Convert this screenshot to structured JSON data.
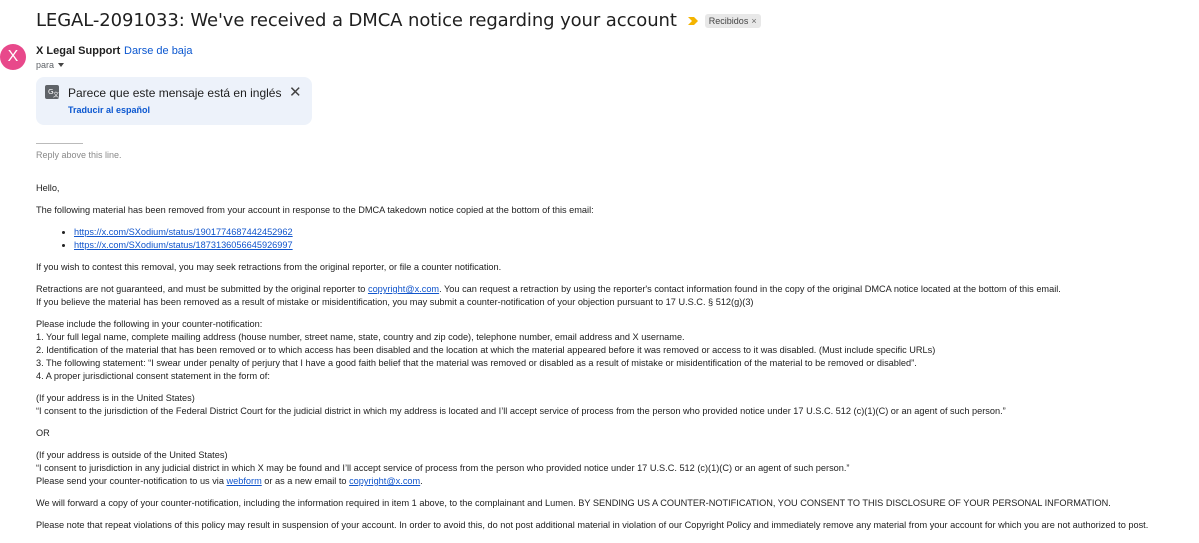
{
  "subject": "LEGAL-2091033: We've received a DMCA notice regarding your account",
  "label_chip": {
    "text": "Recibidos",
    "close": "×"
  },
  "icons": {
    "importance": "importance-marker-icon",
    "translate": "translate-icon",
    "close": "close-icon",
    "caret": "caret-down-icon"
  },
  "colors": {
    "avatar_bg": "#e8498b",
    "link": "#1155cc",
    "accent": "#0b57d0",
    "translate_bg": "#edf2fa",
    "importance": "#f4b400"
  },
  "sender": {
    "avatar_letter": "X",
    "name": "X Legal Support",
    "unsubscribe": "Darse de baja",
    "to": "para"
  },
  "translate_banner": {
    "title": "Parece que este mensaje está en inglés",
    "link": "Traducir al español",
    "close": "✕"
  },
  "reply_above": "Reply above this line.",
  "body": {
    "greeting": "Hello,",
    "intro": "The following material has been removed from your account in response to the DMCA takedown notice copied at the bottom of this email:",
    "links": [
      "https://x.com/SXodium/status/1901774687442452962",
      "https://x.com/SXodium/status/1873136056645926997"
    ],
    "contest": "If you wish to contest this removal, you may seek retractions from the original reporter, or file a counter notification.",
    "retractions_a": "Retractions are not guaranteed, and must be submitted by the original reporter to ",
    "retractions_email": "copyright@x.com",
    "retractions_b": ". You can request a retraction by using the reporter's contact information found in the copy of the original DMCA notice located at the bottom of this email.",
    "mistake": "If you believe the material has been removed as a result of mistake or misidentification, you may submit a counter-notification of your objection pursuant to 17 U.S.C. § 512(g)(3)",
    "include_intro": "Please include the following in your counter-notification:",
    "items": [
      "1. Your full legal name, complete mailing address (house number, street name, state, country and zip code), telephone number, email address and X username.",
      "2. Identification of the material that has been removed or to which access has been disabled and the location at which the material appeared before it was removed or access to it was disabled. (Must include specific URLs)",
      "3. The following statement: “I swear under penalty of perjury that I have a good faith belief that the material was removed or disabled as a result of mistake or misidentification of the material to be removed or disabled”.",
      "4. A proper jurisdictional consent statement in the form of:"
    ],
    "us_header": "(If your address is in the United States)",
    "us_statement": "“I consent to the jurisdiction of the Federal District Court for the judicial district in which my address is located and I’ll accept service of process from the person who provided notice under 17 U.S.C. 512 (c)(1)(C) or an agent of such person.”",
    "or": "OR",
    "outside_header": "(If your address is outside of the United States)",
    "outside_statement": "“I consent to jurisdiction in any judicial district in which X may be found and I’ll accept service of process from the person who provided notice under 17 U.S.C. 512 (c)(1)(C) or an agent of such person.”",
    "send_a": "Please send your counter-notification to us via ",
    "send_webform": "webform",
    "send_b": " or as a new email to ",
    "send_email": "copyright@x.com",
    "send_c": ".",
    "forward": "We will forward a copy of your counter-notification, including the information required in item 1 above, to the complainant and Lumen. BY SENDING US A COUNTER-NOTIFICATION, YOU CONSENT TO THIS DISCLOSURE OF YOUR PERSONAL INFORMATION.",
    "repeat": "Please note that repeat violations of this policy may result in suspension of your account. In order to avoid this, do not post additional material in violation of our Copyright Policy and immediately remove any material from your account for which you are not authorized to post."
  }
}
